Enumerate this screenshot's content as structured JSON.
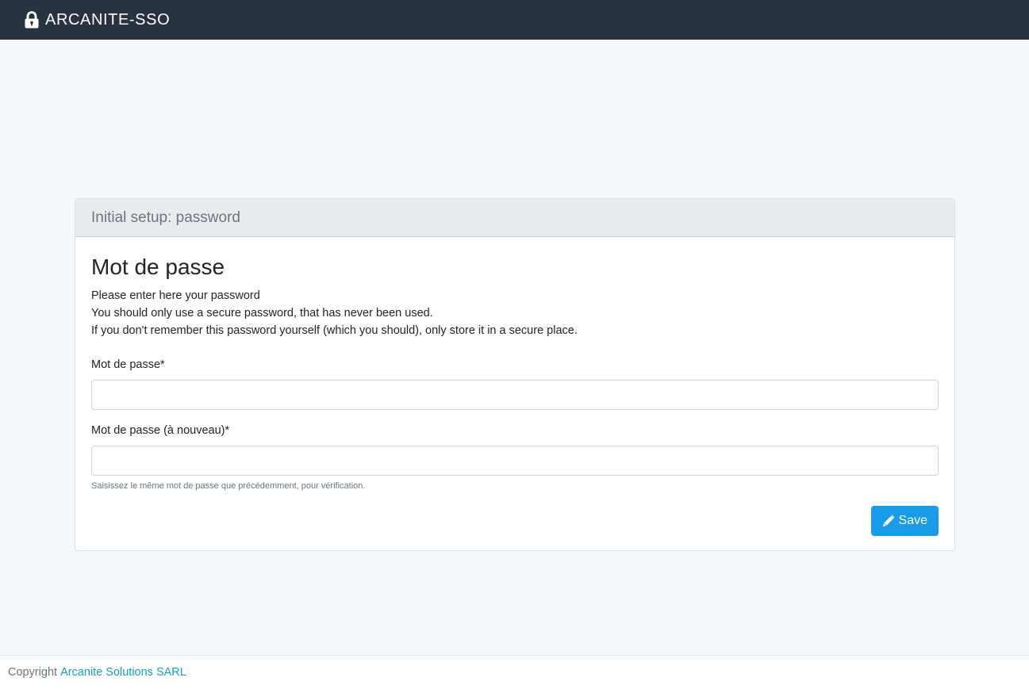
{
  "navbar": {
    "brand_icon": "lock-icon",
    "brand_text": "ARCANITE-SSO"
  },
  "card": {
    "header": "Initial setup: password",
    "title": "Mot de passe",
    "intro": [
      "Please enter here your password",
      "You should only use a secure password, that has never been used.",
      "If you don't remember this password yourself (which you should), only store it in a secure place."
    ],
    "fields": [
      {
        "label": "Mot de passe*",
        "value": "",
        "placeholder": ""
      },
      {
        "label": "Mot de passe (à nouveau)*",
        "value": "",
        "placeholder": "",
        "help": "Saisissez le même mot de passe que précédemment, pour vérification."
      }
    ],
    "save_button": {
      "icon": "pencil-icon",
      "label": "Save"
    }
  },
  "footer": {
    "prefix": "Copyright",
    "link": "Arcanite Solutions SARL"
  },
  "colors": {
    "navbar_bg": "#283340",
    "page_bg": "#f5f8fa",
    "primary": "#1a9be8",
    "link": "#17a2b8"
  }
}
